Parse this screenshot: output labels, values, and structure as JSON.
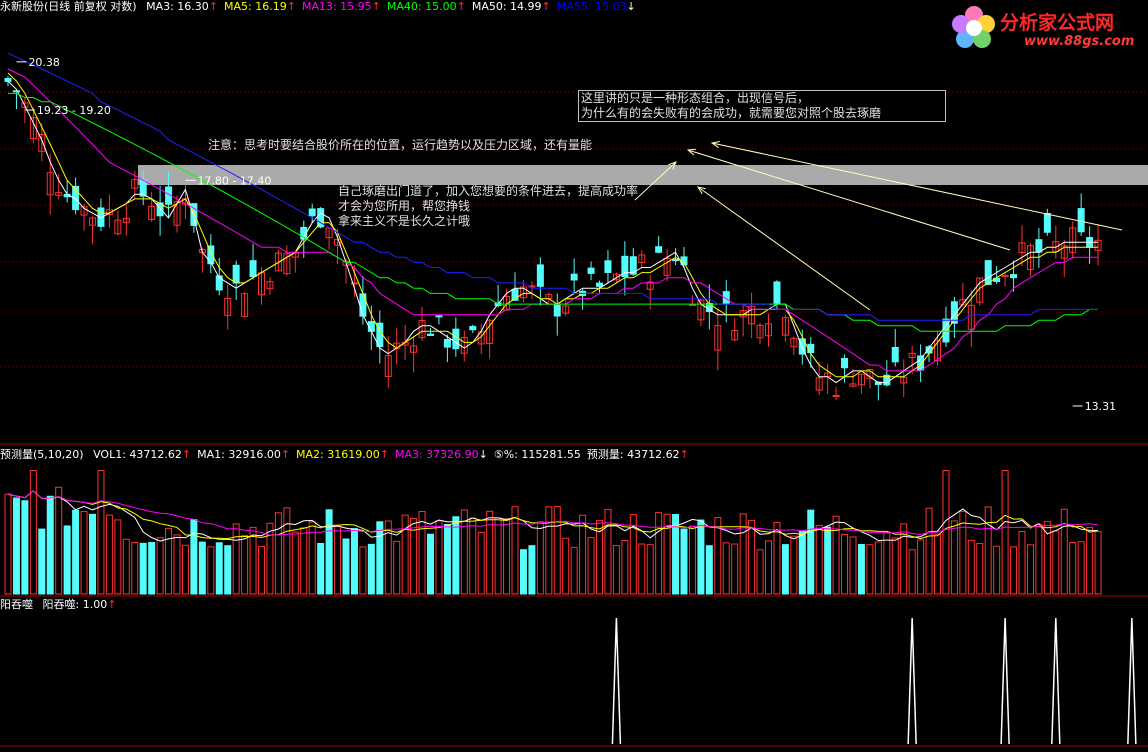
{
  "price_panel": {
    "title": "永新股份(日线 前复权 对数)",
    "indicators": [
      {
        "label": "MA3: 16.30",
        "color": "#ffffff",
        "arrow": "↑",
        "arrow_color": "#ff3030"
      },
      {
        "label": "MA5: 16.19",
        "color": "#ffff00",
        "arrow": "↑",
        "arrow_color": "#ff3030"
      },
      {
        "label": "MA13: 15.95",
        "color": "#ff00ff",
        "arrow": "↑",
        "arrow_color": "#ff3030"
      },
      {
        "label": "MA40: 15.00",
        "color": "#00ff00",
        "arrow": "↑",
        "arrow_color": "#ff3030"
      },
      {
        "label": "MA50: 14.99",
        "color": "#ffffff",
        "arrow": "↑",
        "arrow_color": "#ff3030"
      },
      {
        "label": "MA55: 15.03",
        "color": "#0000ff",
        "arrow": "↓",
        "arrow_color": "#ffffff"
      }
    ]
  },
  "volume_panel": {
    "title": "预测量(5,10,20)",
    "indicators": [
      {
        "label": "VOL1: 43712.62",
        "color": "#ffffff",
        "arrow": "↑",
        "arrow_color": "#ff3030"
      },
      {
        "label": "MA1: 32916.00",
        "color": "#ffffff",
        "arrow": "↑",
        "arrow_color": "#ff3030"
      },
      {
        "label": "MA2: 31619.00",
        "color": "#ffff00",
        "arrow": "↑",
        "arrow_color": "#ff3030"
      },
      {
        "label": "MA3: 37326.90",
        "color": "#ff00ff",
        "arrow": "↓",
        "arrow_color": "#ffffff"
      },
      {
        "label": "⑤%: 115281.55",
        "color": "#ffffff",
        "arrow": "",
        "arrow_color": "#ffffff"
      },
      {
        "label": "预测量: 43712.62",
        "color": "#ffffff",
        "arrow": "↑",
        "arrow_color": "#ff3030"
      }
    ]
  },
  "indicator_panel": {
    "title": "阳吞噬",
    "indicators": [
      {
        "label": "阳吞噬: 1.00",
        "color": "#ffffff",
        "arrow": "↑",
        "arrow_color": "#ff3030"
      }
    ]
  },
  "annotations": {
    "box_line1": "这里讲的只是一种形态组合，出现信号后，",
    "box_line2": "为什么有的会失败有的会成功，就需要您对照个股去琢磨",
    "position_note": "注意：思考时要结合股价所在的位置，运行趋势以及压力区域，还有量能",
    "study_line1": "自己琢磨出门道了，加入您想要的条件进去，提高成功率",
    "study_line2": "才会为您所用，帮您挣钱",
    "study_line3": "拿来主义不是长久之计哦"
  },
  "logo": {
    "name": "分析家公式网",
    "url": "www.88gs.com"
  },
  "colors": {
    "up": "#ff3030",
    "down": "#54fcfc",
    "grid": "#800000",
    "band": "#c8c8c8"
  },
  "chart_data": {
    "type": "candlestick",
    "scale": "log",
    "price_labels": [
      {
        "text": "20.38",
        "index": 1,
        "value": 20.38
      },
      {
        "text": "19.23 - 19.20",
        "index": 2,
        "value": 19.2
      },
      {
        "text": "17.80 - 17.40",
        "index": 21,
        "value": 17.6
      },
      {
        "text": "13.31",
        "index": 126,
        "value": 13.31
      }
    ],
    "series": [
      {
        "name": "MA3",
        "color": "#ffffff",
        "values": [
          19.9,
          19.7,
          19.3,
          18.9,
          18.5,
          18.0,
          17.6,
          17.3,
          17.2,
          17.0,
          16.9,
          16.8,
          16.9,
          17.0,
          17.1,
          17.3,
          17.3,
          17.2,
          17.0,
          16.8,
          17.1,
          17.4,
          16.8,
          16.1,
          15.9,
          15.6,
          15.5,
          15.4,
          15.5,
          15.6,
          15.7,
          15.8,
          15.9,
          16.0,
          16.1,
          16.4,
          16.7,
          16.9,
          16.8,
          16.4,
          15.9,
          15.4,
          14.9,
          14.6,
          14.3,
          14.2,
          14.3,
          14.4,
          14.6,
          14.7,
          14.7,
          14.6,
          14.5,
          14.4,
          14.3,
          14.4,
          14.6,
          14.9,
          15.1,
          15.3,
          15.4,
          15.4,
          15.3,
          15.2,
          15.1,
          15.1,
          15.2,
          15.3,
          15.4,
          15.4,
          15.4,
          15.5,
          15.6,
          15.7,
          15.7,
          15.8,
          15.8,
          15.9,
          16.0,
          16.1,
          15.8,
          15.4,
          15.1,
          15.0,
          14.9,
          14.9,
          14.9,
          14.9,
          15.0,
          15.0,
          15.0,
          15.1,
          15.1,
          14.7,
          14.3,
          14.0,
          13.8,
          13.8,
          13.7,
          13.8,
          13.9,
          13.9,
          13.8,
          13.7,
          13.7,
          13.8,
          13.9,
          14.0,
          14.1,
          14.3,
          14.5,
          14.7,
          14.9,
          15.1,
          15.3,
          15.5,
          15.6,
          15.7,
          15.8,
          15.9,
          16.0,
          16.1,
          16.1,
          16.2,
          16.2,
          16.3,
          16.3,
          16.3,
          16.3,
          16.3
        ]
      },
      {
        "name": "MA5",
        "color": "#ffff00",
        "values": [
          20.1,
          19.9,
          19.6,
          19.2,
          18.8,
          18.4,
          18.0,
          17.6,
          17.4,
          17.2,
          17.0,
          16.9,
          16.9,
          17.0,
          17.1,
          17.2,
          17.2,
          17.2,
          17.1,
          17.0,
          17.1,
          17.2,
          16.9,
          16.5,
          16.1,
          15.8,
          15.6,
          15.5,
          15.5,
          15.6,
          15.7,
          15.8,
          15.9,
          16.0,
          16.1,
          16.3,
          16.5,
          16.7,
          16.7,
          16.5,
          16.1,
          15.7,
          15.3,
          14.9,
          14.6,
          14.4,
          14.3,
          14.4,
          14.5,
          14.6,
          14.6,
          14.6,
          14.6,
          14.5,
          14.4,
          14.4,
          14.5,
          14.7,
          14.9,
          15.1,
          15.2,
          15.3,
          15.3,
          15.2,
          15.2,
          15.1,
          15.2,
          15.2,
          15.3,
          15.3,
          15.4,
          15.4,
          15.5,
          15.6,
          15.6,
          15.7,
          15.7,
          15.8,
          15.9,
          16.0,
          15.9,
          15.6,
          15.3,
          15.1,
          15.0,
          14.9,
          14.9,
          14.9,
          14.9,
          14.9,
          15.0,
          15.0,
          15.0,
          14.8,
          14.5,
          14.2,
          14.0,
          13.9,
          13.8,
          13.8,
          13.8,
          13.9,
          13.9,
          13.8,
          13.8,
          13.8,
          13.8,
          13.9,
          14.0,
          14.2,
          14.4,
          14.6,
          14.8,
          15.0,
          15.2,
          15.4,
          15.5,
          15.6,
          15.7,
          15.8,
          15.9,
          16.0,
          16.0,
          16.1,
          16.1,
          16.2,
          16.2,
          16.2,
          16.2,
          16.2
        ]
      },
      {
        "name": "MA13",
        "color": "#ff00ff",
        "values": [
          20.2,
          20.1,
          20.0,
          19.8,
          19.6,
          19.4,
          19.2,
          19.0,
          18.8,
          18.6,
          18.4,
          18.2,
          18.0,
          17.9,
          17.8,
          17.7,
          17.6,
          17.5,
          17.4,
          17.3,
          17.2,
          17.1,
          17.0,
          16.9,
          16.8,
          16.7,
          16.6,
          16.5,
          16.4,
          16.3,
          16.2,
          16.2,
          16.2,
          16.1,
          16.1,
          16.1,
          16.1,
          16.1,
          16.1,
          16.0,
          15.9,
          15.8,
          15.6,
          15.5,
          15.3,
          15.2,
          15.1,
          15.0,
          14.9,
          14.9,
          14.9,
          14.9,
          14.9,
          14.9,
          14.9,
          14.9,
          14.9,
          14.9,
          14.9,
          15.0,
          15.0,
          15.0,
          15.1,
          15.1,
          15.1,
          15.1,
          15.1,
          15.2,
          15.2,
          15.2,
          15.3,
          15.3,
          15.3,
          15.4,
          15.4,
          15.5,
          15.5,
          15.5,
          15.6,
          15.6,
          15.6,
          15.5,
          15.5,
          15.4,
          15.3,
          15.2,
          15.1,
          15.1,
          15.0,
          15.0,
          15.0,
          15.0,
          15.0,
          14.9,
          14.8,
          14.7,
          14.6,
          14.5,
          14.4,
          14.3,
          14.2,
          14.1,
          14.0,
          14.0,
          13.9,
          13.9,
          13.9,
          13.9,
          13.9,
          14.0,
          14.1,
          14.2,
          14.3,
          14.5,
          14.6,
          14.8,
          14.9,
          15.1,
          15.2,
          15.4,
          15.5,
          15.6,
          15.7,
          15.8,
          15.9,
          15.9,
          16.0,
          16.0,
          16.0,
          16.0
        ]
      },
      {
        "name": "MA40",
        "color": "#00ff00",
        "values": [
          19.6,
          19.6,
          19.5,
          19.5,
          19.4,
          19.4,
          19.3,
          19.2,
          19.1,
          19.0,
          18.9,
          18.8,
          18.7,
          18.6,
          18.5,
          18.4,
          18.3,
          18.2,
          18.1,
          18.0,
          17.9,
          17.8,
          17.7,
          17.6,
          17.5,
          17.4,
          17.3,
          17.2,
          17.1,
          17.0,
          16.9,
          16.8,
          16.7,
          16.6,
          16.5,
          16.4,
          16.3,
          16.2,
          16.1,
          16.0,
          15.9,
          15.9,
          15.8,
          15.7,
          15.6,
          15.6,
          15.5,
          15.5,
          15.4,
          15.4,
          15.3,
          15.3,
          15.3,
          15.2,
          15.2,
          15.2,
          15.2,
          15.2,
          15.1,
          15.1,
          15.1,
          15.1,
          15.1,
          15.1,
          15.1,
          15.1,
          15.1,
          15.1,
          15.1,
          15.1,
          15.1,
          15.1,
          15.1,
          15.1,
          15.1,
          15.1,
          15.1,
          15.1,
          15.1,
          15.1,
          15.1,
          15.1,
          15.1,
          15.1,
          15.1,
          15.1,
          15.1,
          15.1,
          15.1,
          15.1,
          15.1,
          15.1,
          15.1,
          15.0,
          15.0,
          15.0,
          15.0,
          14.9,
          14.9,
          14.9,
          14.8,
          14.8,
          14.8,
          14.7,
          14.7,
          14.7,
          14.7,
          14.7,
          14.6,
          14.6,
          14.6,
          14.6,
          14.6,
          14.6,
          14.6,
          14.6,
          14.6,
          14.6,
          14.7,
          14.7,
          14.7,
          14.7,
          14.8,
          14.8,
          14.8,
          14.9,
          14.9,
          14.9,
          15.0,
          15.0
        ]
      },
      {
        "name": "MA55",
        "color": "#2020ff",
        "values": [
          20.6,
          20.5,
          20.4,
          20.3,
          20.2,
          20.1,
          20.0,
          19.9,
          19.8,
          19.7,
          19.6,
          19.4,
          19.3,
          19.2,
          19.1,
          19.0,
          18.9,
          18.8,
          18.7,
          18.5,
          18.4,
          18.3,
          18.2,
          18.1,
          18.0,
          17.9,
          17.8,
          17.7,
          17.6,
          17.5,
          17.4,
          17.3,
          17.2,
          17.1,
          17.0,
          16.9,
          16.8,
          16.7,
          16.6,
          16.5,
          16.4,
          16.3,
          16.3,
          16.2,
          16.1,
          16.1,
          16.0,
          16.0,
          15.9,
          15.9,
          15.8,
          15.8,
          15.7,
          15.7,
          15.7,
          15.6,
          15.6,
          15.6,
          15.5,
          15.5,
          15.5,
          15.5,
          15.4,
          15.4,
          15.4,
          15.4,
          15.4,
          15.3,
          15.3,
          15.3,
          15.3,
          15.3,
          15.3,
          15.3,
          15.3,
          15.3,
          15.2,
          15.2,
          15.2,
          15.2,
          15.2,
          15.2,
          15.2,
          15.2,
          15.1,
          15.1,
          15.1,
          15.1,
          15.1,
          15.1,
          15.1,
          15.0,
          15.0,
          15.0,
          15.0,
          15.0,
          15.0,
          14.9,
          14.9,
          14.9,
          14.9,
          14.9,
          14.9,
          14.8,
          14.8,
          14.8,
          14.8,
          14.8,
          14.8,
          14.8,
          14.8,
          14.8,
          14.8,
          14.8,
          14.9,
          14.9,
          14.9,
          14.9,
          14.9,
          14.9,
          14.9,
          14.9,
          15.0,
          15.0,
          15.0,
          15.0,
          15.0,
          15.0,
          15.0,
          15.0
        ]
      }
    ]
  }
}
